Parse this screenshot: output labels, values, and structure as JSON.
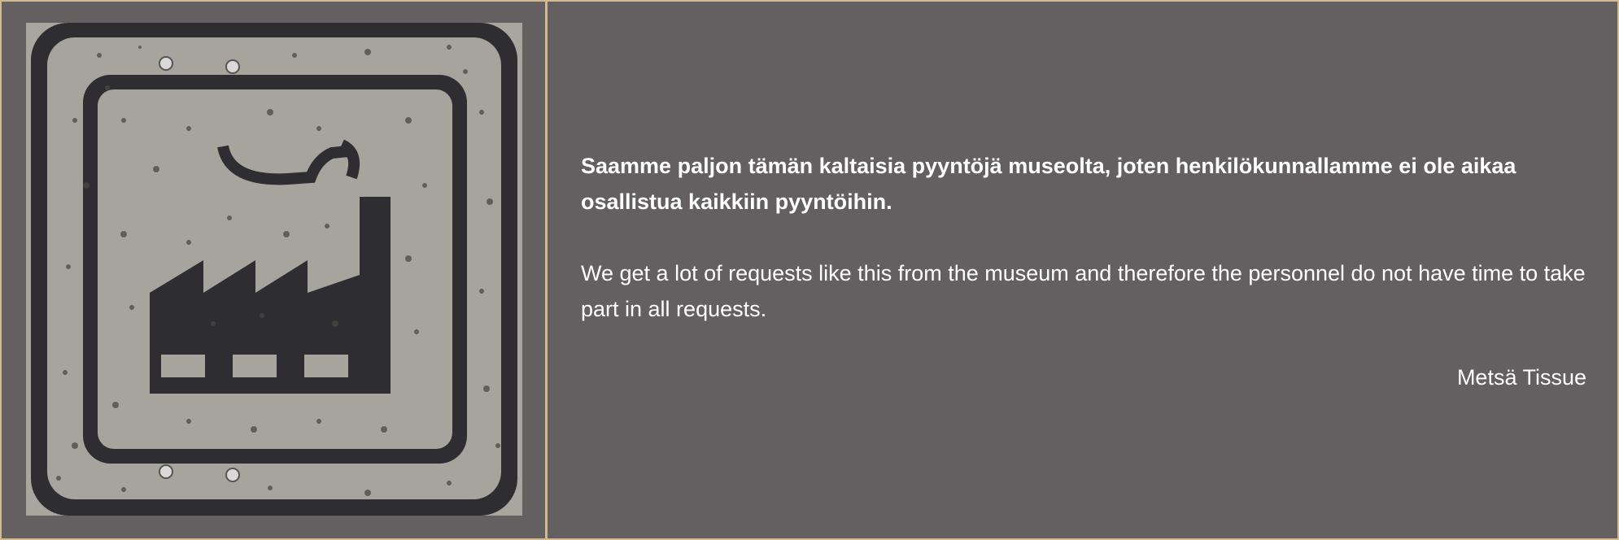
{
  "message": {
    "finnish": "Saamme paljon tämän kaltaisia pyyntöjä museolta, joten henkilökunnallamme ei ole aikaa osallistua kaikkiin pyyntöihin.",
    "english": "We get a lot of requests like this from the museum and therefore the personnel do not have time to take part in all requests.",
    "signature": "Metsä Tissue"
  },
  "colors": {
    "panel_background": "#645f60",
    "border": "#d2b98f",
    "text": "#ffffff",
    "sign_surface": "#a7a49d",
    "sign_ink": "#2d2d32"
  },
  "icons": {
    "photo": "factory-sign-icon"
  }
}
